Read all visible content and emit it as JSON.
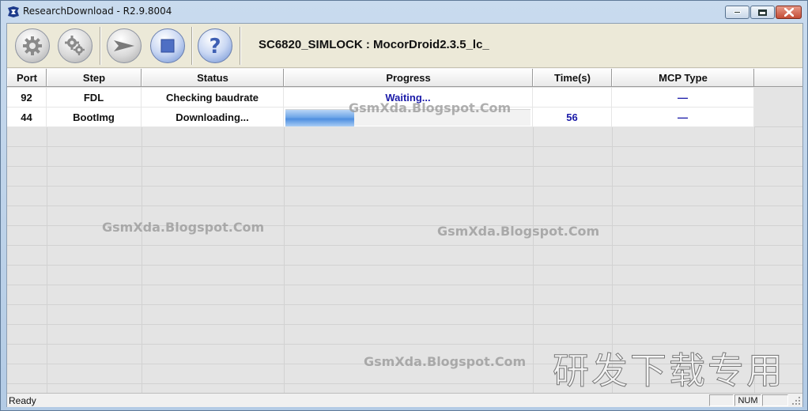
{
  "window": {
    "title": "ResearchDownload - R2.9.8004"
  },
  "toolbar": {
    "buttons": [
      {
        "name": "settings-button",
        "icon": "gear-icon"
      },
      {
        "name": "advanced-settings-button",
        "icon": "gears-icon"
      },
      {
        "name": "start-button",
        "icon": "play-arrow-icon"
      },
      {
        "name": "stop-button",
        "icon": "stop-square-icon"
      },
      {
        "name": "help-button",
        "icon": "question-icon"
      }
    ],
    "title": "SC6820_SIMLOCK : MocorDroid2.3.5_lc_"
  },
  "table": {
    "columns": [
      "Port",
      "Step",
      "Status",
      "Progress",
      "Time(s)",
      "MCP Type"
    ],
    "rows": [
      {
        "port": "92",
        "step": "FDL",
        "status": "Checking baudrate",
        "progress_text": "Waiting...",
        "time": "",
        "mcp": "—",
        "progress_fraction": 0
      },
      {
        "port": "44",
        "step": "BootImg",
        "status": "Downloading...",
        "progress_text": "",
        "time": "56",
        "mcp": "—",
        "progress_fraction": 0.28
      }
    ]
  },
  "watermarks": {
    "top": "GsmXda.Blogspot.Com",
    "left": "GsmXda.Blogspot.Com",
    "center": "GsmXda.Blogspot.Com",
    "bottom": "GsmXda.Blogspot.Com",
    "chinese": "研发下载专用"
  },
  "statusbar": {
    "text": "Ready",
    "num": "NUM"
  }
}
